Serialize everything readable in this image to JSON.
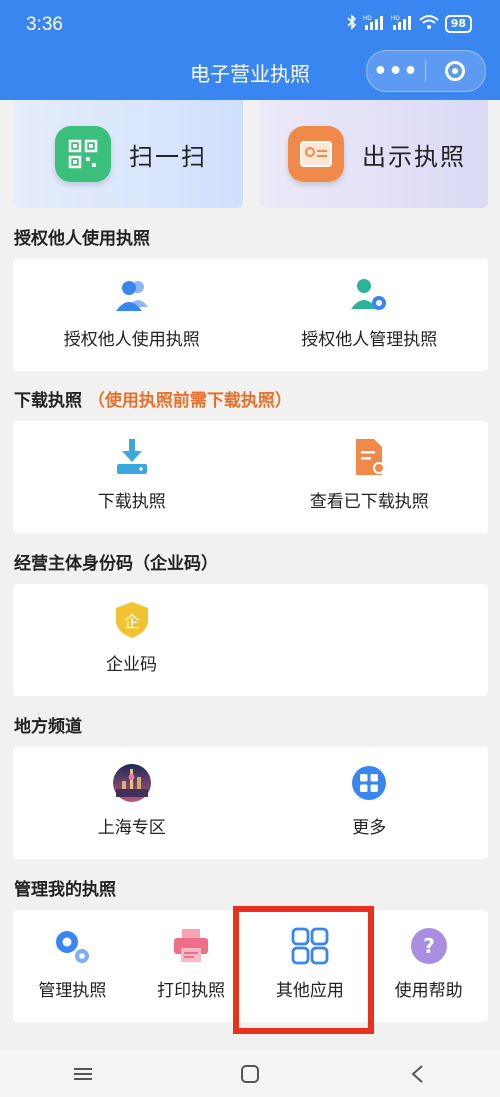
{
  "status": {
    "time": "3:36",
    "battery": "98",
    "hd1": "HD",
    "hd2": "HD"
  },
  "header": {
    "title": "电子营业执照",
    "more": "•••"
  },
  "top_actions": [
    {
      "label": "扫一扫",
      "icon": "qrcode-icon",
      "color": "#3bbf7d"
    },
    {
      "label": "出示执照",
      "icon": "license-card-icon",
      "color": "#f08a4b"
    }
  ],
  "sections": {
    "authorize": {
      "title": "授权他人使用执照",
      "items": [
        {
          "label": "授权他人使用执照",
          "icon": "users-icon"
        },
        {
          "label": "授权他人管理执照",
          "icon": "user-gear-icon"
        }
      ]
    },
    "download": {
      "title": "下载执照",
      "hint": "（使用执照前需下载执照）",
      "items": [
        {
          "label": "下载执照",
          "icon": "download-icon"
        },
        {
          "label": "查看已下载执照",
          "icon": "downloaded-file-icon"
        }
      ]
    },
    "entity_code": {
      "title": "经营主体身份码（企业码）",
      "items": [
        {
          "label": "企业码",
          "icon": "enterprise-shield-icon",
          "glyph": "企"
        }
      ]
    },
    "local": {
      "title": "地方频道",
      "items": [
        {
          "label": "上海专区",
          "icon": "shanghai-skyline-icon"
        },
        {
          "label": "更多",
          "icon": "grid-more-icon"
        }
      ]
    },
    "manage": {
      "title": "管理我的执照",
      "items": [
        {
          "label": "管理执照",
          "icon": "gears-icon"
        },
        {
          "label": "打印执照",
          "icon": "printer-icon"
        },
        {
          "label": "其他应用",
          "icon": "apps-grid-icon"
        },
        {
          "label": "使用帮助",
          "icon": "help-icon",
          "glyph": "?"
        }
      ]
    }
  },
  "colors": {
    "brand": "#3a86f0",
    "highlight": "#e8321e",
    "hint": "#e8702a"
  }
}
